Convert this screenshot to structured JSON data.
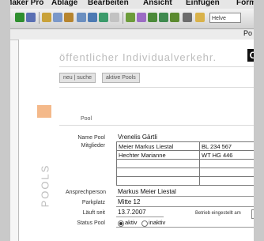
{
  "menubar": [
    "Maker Pro",
    "Ablage",
    "Bearbeiten",
    "Ansicht",
    "Einfügen",
    "Forma"
  ],
  "toolbar": {
    "icons": [
      "check-icon",
      "format-icon",
      "cut-icon",
      "copy-icon",
      "paste-icon",
      "undo-icon",
      "table-icon",
      "image-icon",
      "text-icon",
      "chart-icon",
      "shape-icon",
      "frame-icon",
      "link-icon",
      "help-icon"
    ],
    "font_select": "Helve"
  },
  "ruler": {
    "label": "Po"
  },
  "page": {
    "tagline": "öffentlicher Individualverkehr.",
    "logo_letter": "C",
    "buttons": {
      "new_search": "neu | suche",
      "active_pools": "aktive Pools"
    },
    "section_vertical": "POOLS",
    "section_header": "Pool",
    "form": {
      "name_label": "Name Pool",
      "name_value": "Vrenelis Gärtli",
      "members_label": "Mitglieder",
      "members": [
        [
          "Meier Markus Liestal",
          "BL 234 567"
        ],
        [
          "Hechter Marianne",
          "WT HG 446"
        ],
        [
          "",
          ""
        ],
        [
          "",
          ""
        ],
        [
          "",
          ""
        ]
      ],
      "contact_label": "Ansprechperson",
      "contact_value": "Markus Meier Liestal",
      "parking_label": "Parkplatz",
      "parking_value": "Mitte 12",
      "since_label": "Läuft seit",
      "since_value": "13.7.2007",
      "operating_label": "Betrieb eingestellt am",
      "status_label": "Status Pool",
      "status_active": "aktiv",
      "status_inactive": "inaktiv",
      "status_selected": "aktiv"
    }
  },
  "colors": {
    "accent": "#f4b98a",
    "watermark": "#bdbdbd"
  }
}
